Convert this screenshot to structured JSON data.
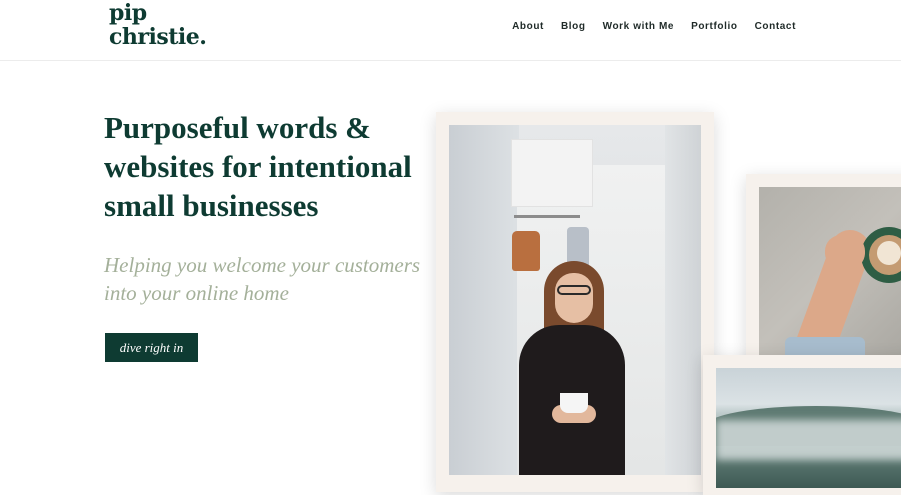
{
  "brand": {
    "logo_line1": "pip",
    "logo_line2": "christie."
  },
  "nav": {
    "items": [
      {
        "label": "About"
      },
      {
        "label": "Blog"
      },
      {
        "label": "Work with Me"
      },
      {
        "label": "Portfolio"
      },
      {
        "label": "Contact"
      }
    ]
  },
  "hero": {
    "headline": "Purposeful words & websites for intentional small businesses",
    "subheadline": "Helping you welcome your customers into your online home",
    "cta_label": "dive right in"
  },
  "colors": {
    "brand_green": "#0e3b32",
    "sage": "#a4b09a",
    "frame_cream": "#f6f1ec"
  }
}
